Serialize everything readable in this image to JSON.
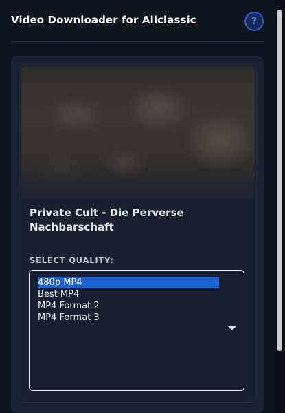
{
  "header": {
    "title": "Video Downloader for Allclassic",
    "help_label": "?"
  },
  "video": {
    "title": "Private Cult - Die Perverse Nachbarschaft"
  },
  "quality": {
    "label": "SELECT QUALITY:",
    "options": [
      "480p MP4",
      "Best MP4",
      "MP4 Format 2",
      "MP4 Format 3"
    ],
    "selected": "480p MP4"
  },
  "colors": {
    "background": "#0f151e",
    "card": "#172233",
    "accent": "#1e63d4",
    "help_ring": "#2c5fd6"
  },
  "icons": {
    "help": "question-mark-circle-icon",
    "dropdown": "caret-down-icon"
  }
}
